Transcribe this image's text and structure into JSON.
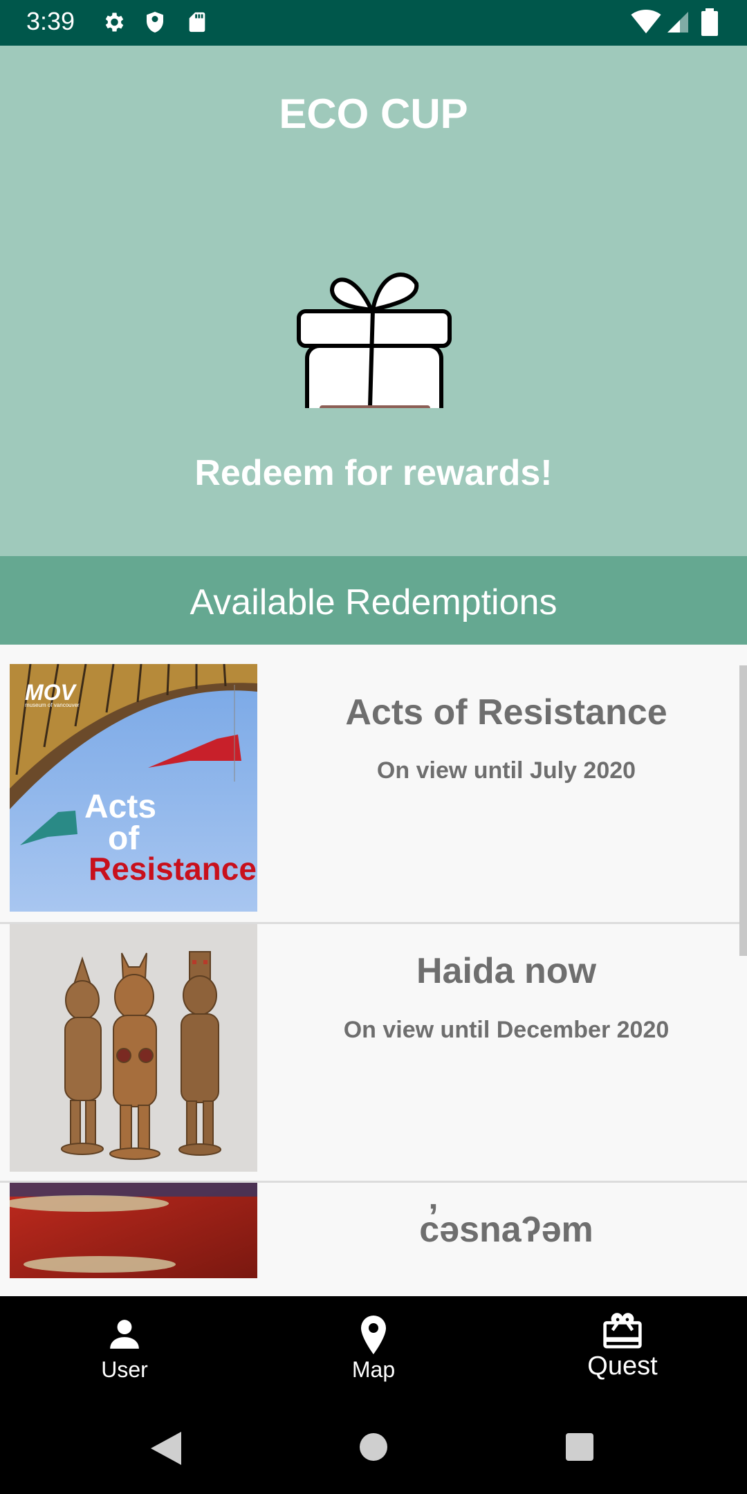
{
  "status_bar": {
    "time": "3:39",
    "icons": [
      "gear-icon",
      "shield-icon",
      "sd-card-icon",
      "wifi-icon",
      "signal-icon",
      "battery-icon"
    ]
  },
  "header": {
    "app_title": "ECO CUP",
    "subtitle": "Redeem for rewards!",
    "icon": "gift-icon"
  },
  "section": {
    "title": "Available Redemptions"
  },
  "redemptions": [
    {
      "title": "Acts of Resistance",
      "subtitle": "On view until July 2020",
      "image_logo": "MOV",
      "image_logo_sub": "museum of vancouver",
      "image_text_line1": "Acts",
      "image_text_line2": "of",
      "image_text_line3": "Resistance"
    },
    {
      "title": "Haida now",
      "subtitle": "On view until December 2020"
    },
    {
      "title": "c̓əsnaʔəm",
      "subtitle": ""
    }
  ],
  "bottom_nav": [
    {
      "label": "User",
      "icon": "person-icon"
    },
    {
      "label": "Map",
      "icon": "map-pin-icon"
    },
    {
      "label": "Quest",
      "icon": "gift-card-icon"
    }
  ],
  "system_nav": [
    "back-icon",
    "home-icon",
    "recents-icon"
  ],
  "colors": {
    "status_bar": "#00574b",
    "header_bg": "#9fc9bb",
    "section_bg": "#65a891",
    "list_bg": "#f8f8f8",
    "item_text": "#6e6e6e",
    "gift_bar": "#8b5e55"
  }
}
